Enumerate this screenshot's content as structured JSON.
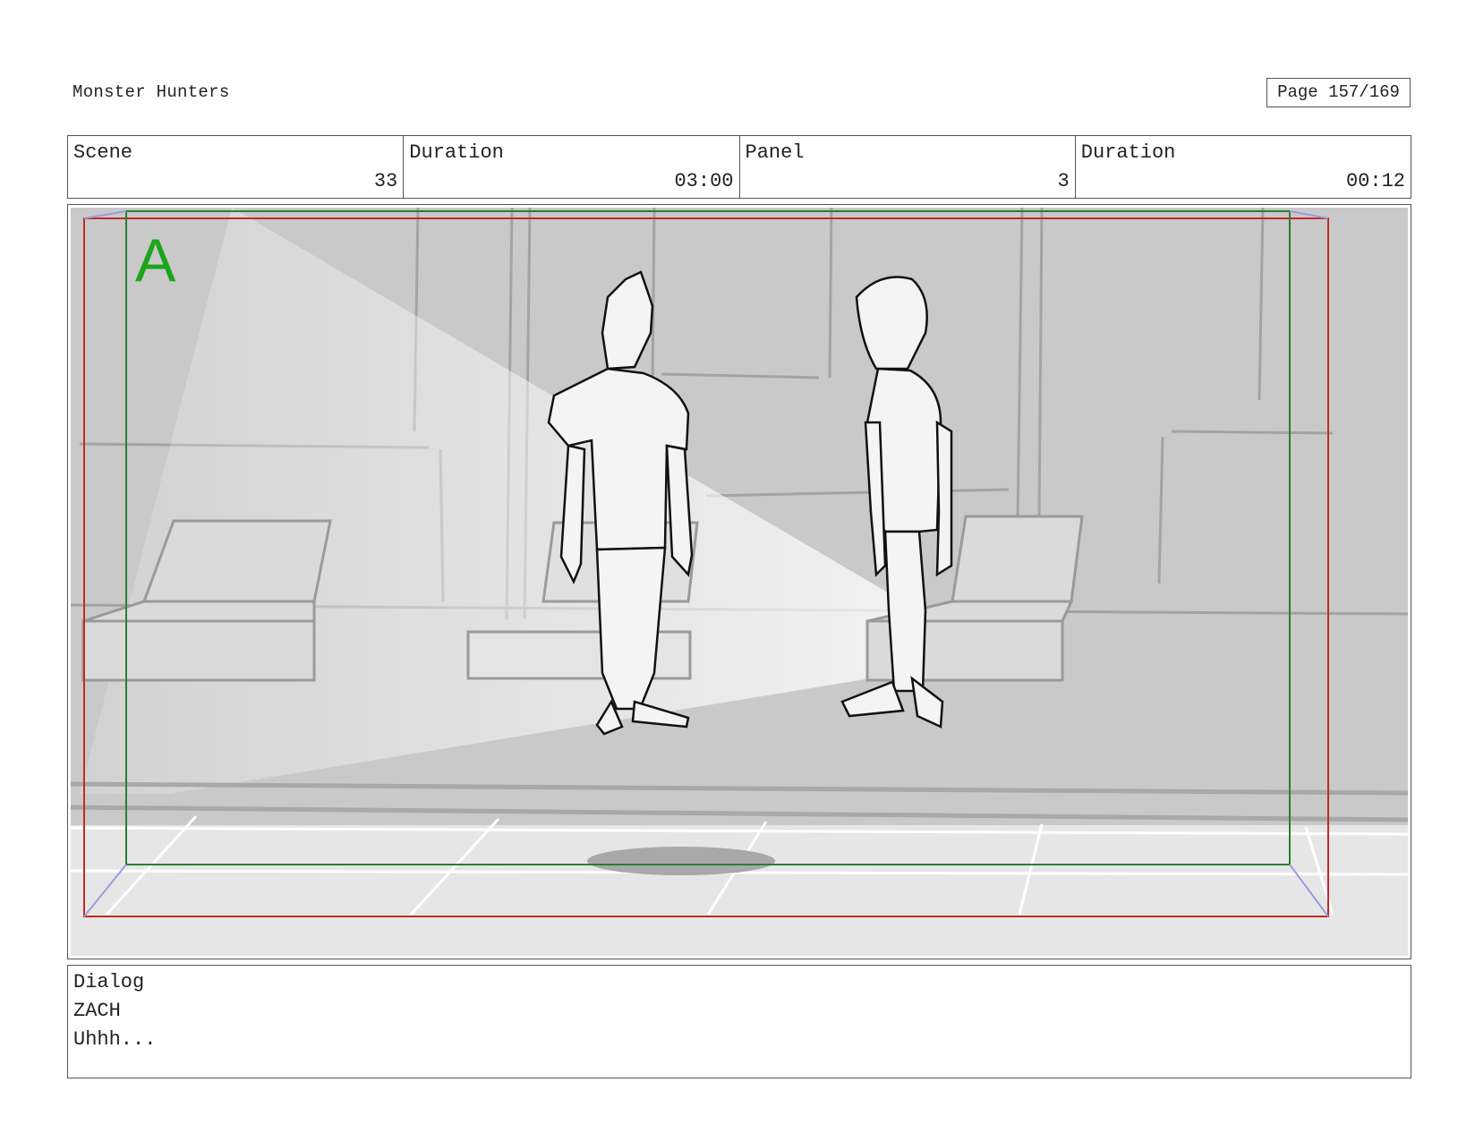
{
  "header": {
    "project_title": "Monster Hunters",
    "page_label": "Page 157/169"
  },
  "info": {
    "scene_label": "Scene",
    "scene_value": "33",
    "scene_duration_label": "Duration",
    "scene_duration_value": "03:00",
    "panel_label": "Panel",
    "panel_value": "3",
    "panel_duration_label": "Duration",
    "panel_duration_value": "00:12"
  },
  "frame": {
    "camera_marker": "A",
    "safe_area_color": "#2e7d32",
    "frame_border_color": "#c62828",
    "marker_color": "#1aa51a"
  },
  "dialog": {
    "label": "Dialog",
    "character": "ZACH",
    "line": "Uhhh..."
  }
}
